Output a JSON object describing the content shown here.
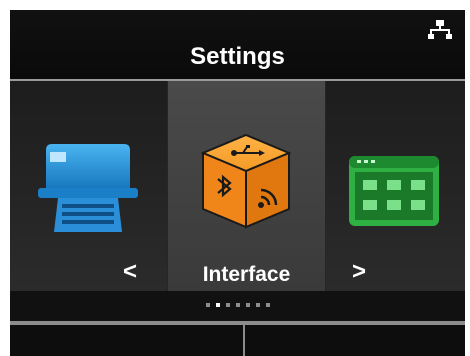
{
  "header": {
    "title": "Settings",
    "network_icon": "network-icon"
  },
  "carousel": {
    "items": [
      {
        "icon": "printer-icon",
        "label": ""
      },
      {
        "icon": "interface-cube-icon",
        "label": "Interface"
      },
      {
        "icon": "keypad-grid-icon",
        "label": ""
      }
    ],
    "selected_label": "Interface",
    "prev_arrow": "<",
    "next_arrow": ">"
  },
  "pager": {
    "count": 7,
    "active_index": 1
  },
  "colors": {
    "printer": "#1f8fd6",
    "interface": "#f08a1c",
    "keypad": "#29a83a",
    "background": "#0d0d0d"
  }
}
